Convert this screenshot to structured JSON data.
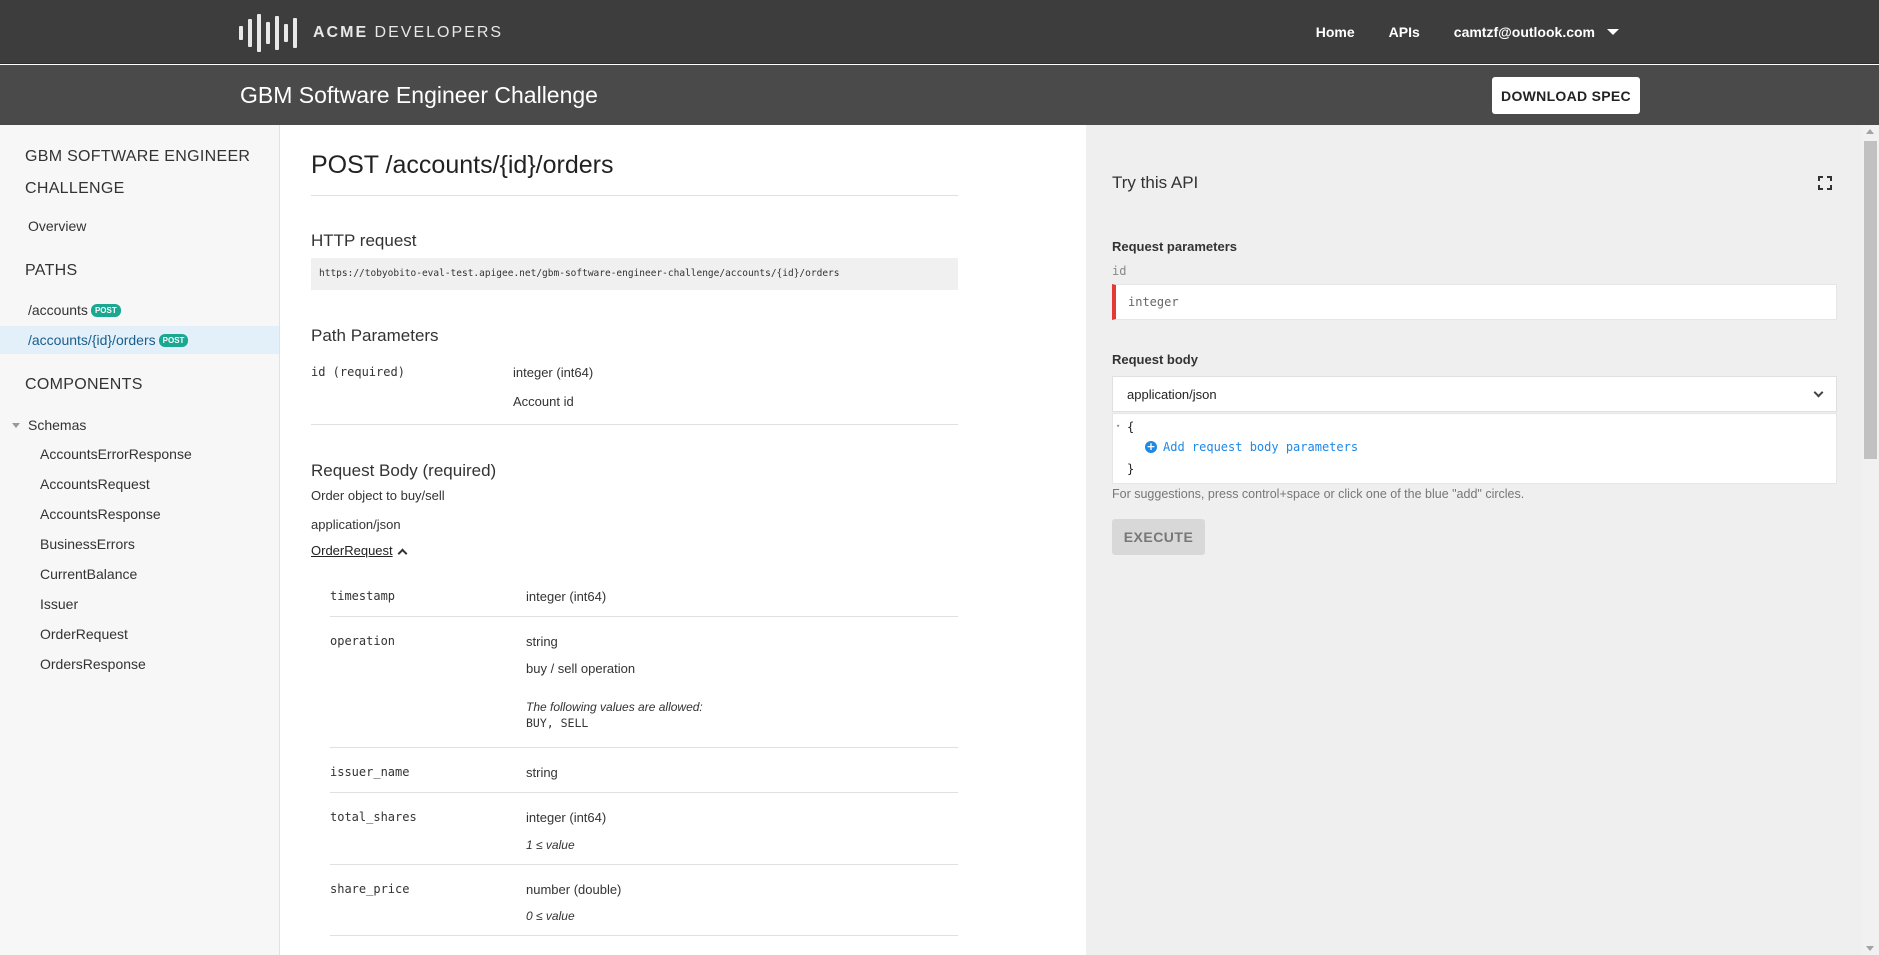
{
  "header": {
    "logo_brand": "ACME",
    "logo_suffix": " DEVELOPERS",
    "nav": {
      "home": "Home",
      "apis": "APIs"
    },
    "user_email": "camtzf@outlook.com"
  },
  "subheader": {
    "title": "GBM Software Engineer Challenge",
    "download_label": "DOWNLOAD SPEC"
  },
  "sidebar": {
    "title": "GBM SOFTWARE ENGINEER CHALLENGE",
    "overview": "Overview",
    "paths_heading": "PATHS",
    "paths": [
      {
        "label": "/accounts",
        "method": "POST"
      },
      {
        "label": "/accounts/{id}/orders",
        "method": "POST"
      }
    ],
    "components_heading": "COMPONENTS",
    "schemas_label": "Schemas",
    "schemas": [
      "AccountsErrorResponse",
      "AccountsRequest",
      "AccountsResponse",
      "BusinessErrors",
      "CurrentBalance",
      "Issuer",
      "OrderRequest",
      "OrdersResponse"
    ]
  },
  "main": {
    "endpoint_title": "POST /accounts/{id}/orders",
    "http_request_heading": "HTTP request",
    "url": "https://tobyobito-eval-test.apigee.net/gbm-software-engineer-challenge/accounts/{id}/orders",
    "path_params_heading": "Path Parameters",
    "path_param": {
      "name": "id (required)",
      "type": "integer (int64)",
      "description": "Account id"
    },
    "request_body_heading": "Request Body (required)",
    "request_body_description": "Order object to buy/sell",
    "content_type": "application/json",
    "schema_link": "OrderRequest",
    "fields": [
      {
        "name": "timestamp",
        "type": "integer (int64)"
      },
      {
        "name": "operation",
        "type": "string",
        "description": "buy / sell operation",
        "allowed_label": "The following values are allowed:",
        "allowed_values": "BUY, SELL"
      },
      {
        "name": "issuer_name",
        "type": "string"
      },
      {
        "name": "total_shares",
        "type": "integer (int64)",
        "constraint": "1 ≤ value"
      },
      {
        "name": "share_price",
        "type": "number (double)",
        "constraint": "0 ≤ value"
      }
    ]
  },
  "try_api": {
    "title": "Try this API",
    "request_params_label": "Request parameters",
    "id_label": "id",
    "id_placeholder": "integer",
    "request_body_label": "Request body",
    "content_type": "application/json",
    "editor_open": "{",
    "add_params_label": "Add request body parameters",
    "editor_close": "}",
    "hint": "For suggestions, press control+space or click one of the blue \"add\" circles.",
    "execute_label": "EXECUTE"
  }
}
